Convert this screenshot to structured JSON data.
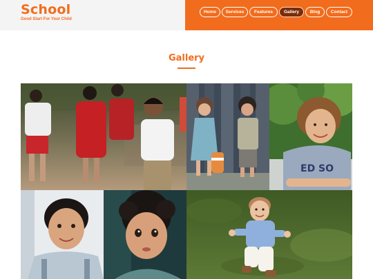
{
  "brand": {
    "name": "School",
    "tagline": "Good Start For Your Child"
  },
  "nav": {
    "items": [
      {
        "label": "Home"
      },
      {
        "label": "Services"
      },
      {
        "label": "Features"
      },
      {
        "label": "Gallery",
        "active": true
      },
      {
        "label": "Blog"
      },
      {
        "label": "Contact"
      }
    ]
  },
  "gallery": {
    "title": "Gallery",
    "photos": [
      {
        "name": "children-walking-photo"
      },
      {
        "name": "kids-with-toy-photo"
      },
      {
        "name": "smiling-boy-photo"
      },
      {
        "name": "boy-portrait-photo"
      },
      {
        "name": "curly-hair-child-photo"
      },
      {
        "name": "toddler-on-grass-photo"
      }
    ]
  },
  "colors": {
    "accent": "#f26c1d",
    "active_nav": "#7a2d08",
    "brand_bg": "#f4f4f4"
  }
}
